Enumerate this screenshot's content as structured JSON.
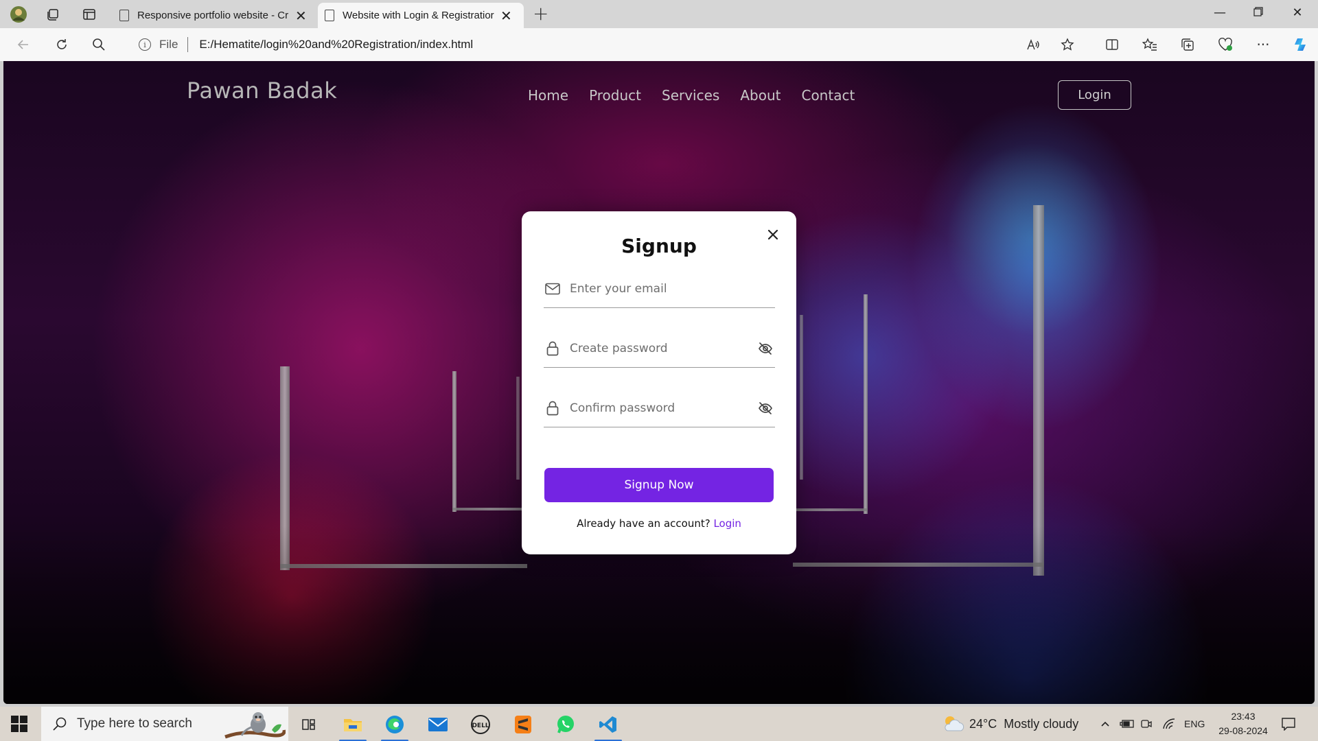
{
  "browser": {
    "tabs": [
      {
        "title": "Responsive portfolio website - Cr",
        "active": false
      },
      {
        "title": "Website with Login & Registratior",
        "active": true
      }
    ],
    "address": {
      "scheme_label": "File",
      "url": "E:/Hematite/login%20and%20Registration/index.html"
    }
  },
  "site": {
    "logo": "Pawan Badak",
    "nav": [
      "Home",
      "Product",
      "Services",
      "About",
      "Contact"
    ],
    "login_button": "Login"
  },
  "modal": {
    "title": "Signup",
    "email_placeholder": "Enter your email",
    "password_placeholder": "Create password",
    "confirm_placeholder": "Confirm password",
    "submit_label": "Signup Now",
    "switch_text": "Already have an account?",
    "switch_link": "Login",
    "accent_color": "#7424e3"
  },
  "taskbar": {
    "search_placeholder": "Type here to search",
    "weather_temp": "24°C",
    "weather_text": "Mostly cloudy",
    "language": "ENG",
    "time": "23:43",
    "date": "29-08-2024"
  }
}
